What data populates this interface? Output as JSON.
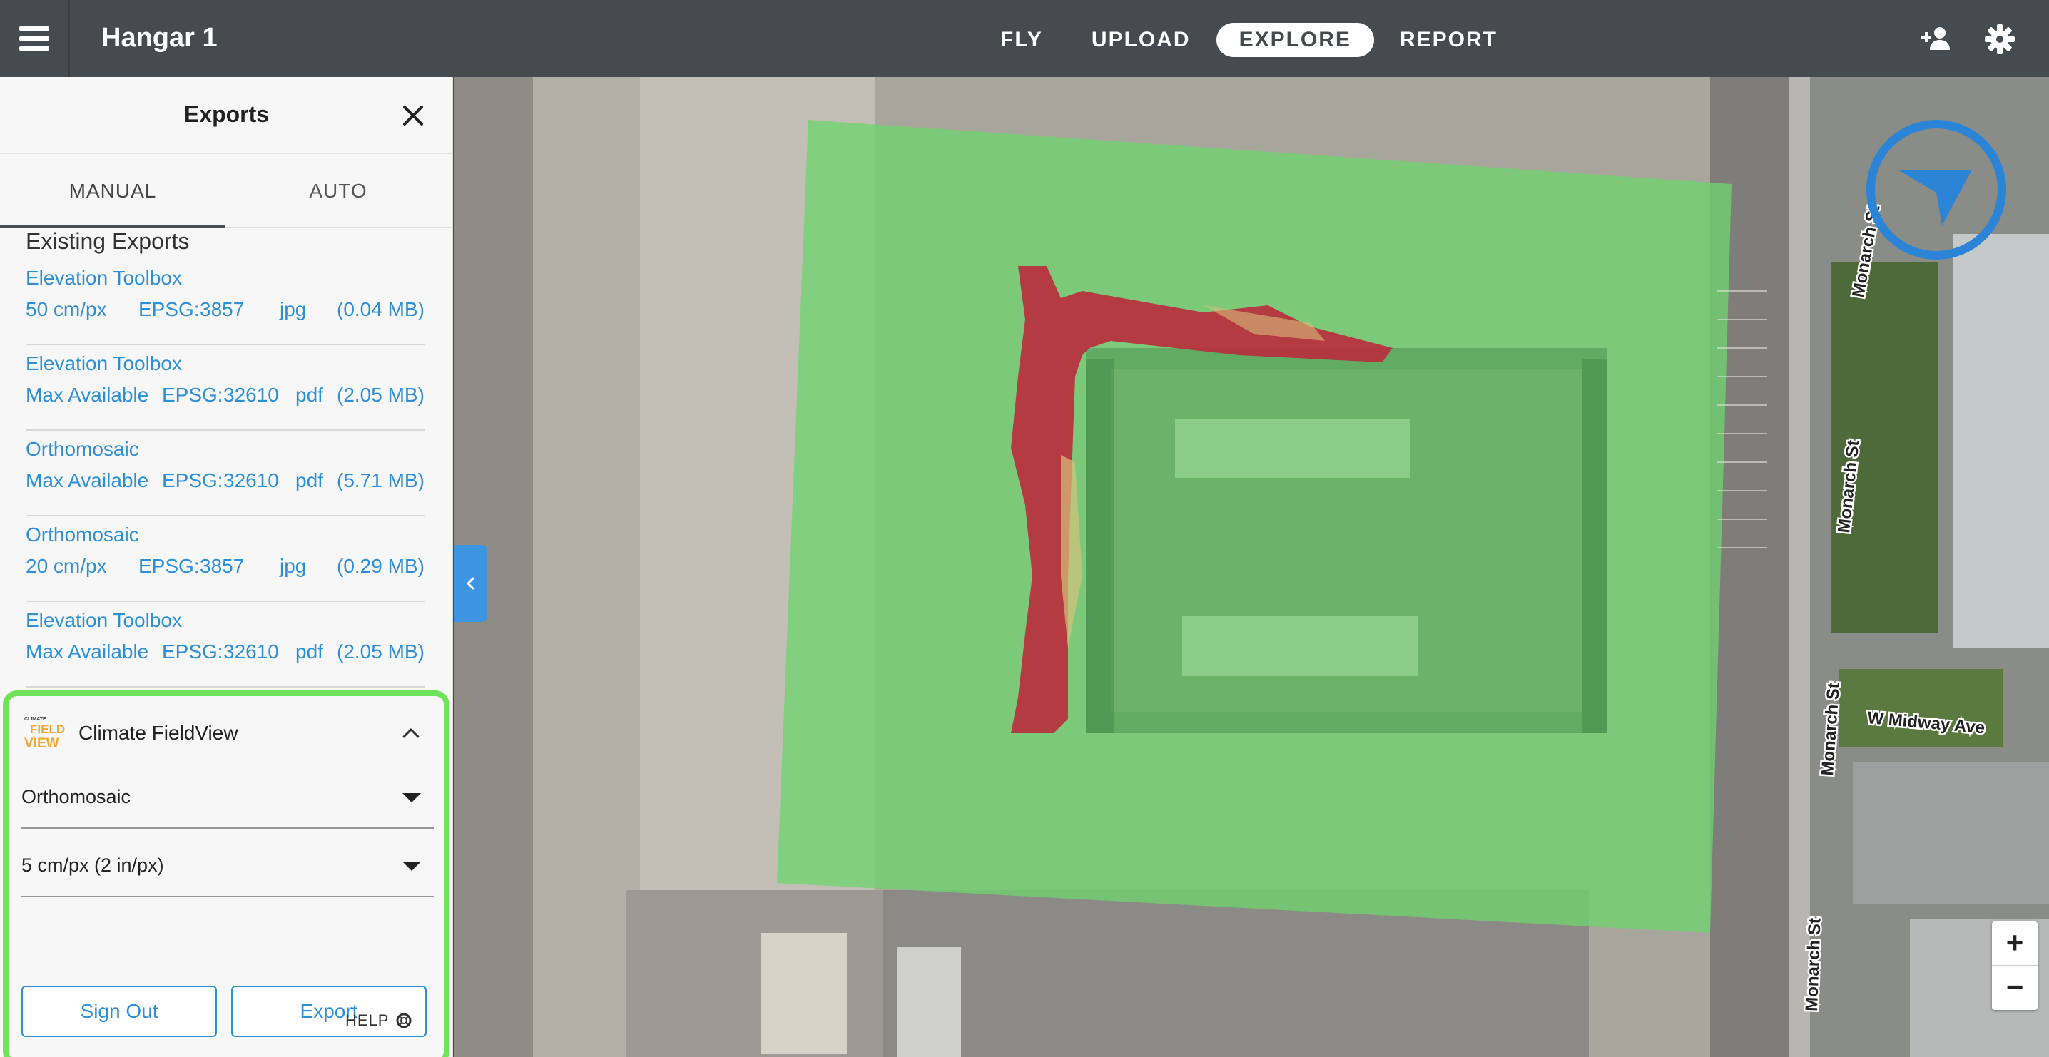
{
  "header": {
    "app_title": "Hangar 1",
    "nav_tabs": [
      {
        "label": "FLY",
        "active": false
      },
      {
        "label": "UPLOAD",
        "active": false
      },
      {
        "label": "EXPLORE",
        "active": true
      },
      {
        "label": "REPORT",
        "active": false
      }
    ]
  },
  "panel": {
    "title": "Exports",
    "tabs": [
      {
        "label": "MANUAL",
        "active": true
      },
      {
        "label": "AUTO",
        "active": false
      }
    ],
    "existing_heading": "Existing Exports",
    "exports": [
      {
        "name": "Elevation Toolbox",
        "resolution": "50 cm/px",
        "epsg_label": "EPSG:",
        "epsg": "3857",
        "format": "jpg",
        "size": "(0.04 MB)"
      },
      {
        "name": "Elevation Toolbox",
        "resolution": "Max Available",
        "epsg_label": "EPSG:",
        "epsg": "32610",
        "format": "pdf",
        "size": "(2.05 MB)"
      },
      {
        "name": "Orthomosaic",
        "resolution": "Max Available",
        "epsg_label": "EPSG:",
        "epsg": "32610",
        "format": "pdf",
        "size": "(5.71 MB)"
      },
      {
        "name": "Orthomosaic",
        "resolution": "20 cm/px",
        "epsg_label": "EPSG:",
        "epsg": "3857",
        "format": "jpg",
        "size": "(0.29 MB)"
      },
      {
        "name": "Elevation Toolbox",
        "resolution": "Max Available",
        "epsg_label": "EPSG:",
        "epsg": "32610",
        "format": "pdf",
        "size": "(2.05 MB)"
      }
    ],
    "fieldview": {
      "logo_text_top": "CLIMATE",
      "logo_text_mid": "FIELD",
      "logo_text_bot": "VIEW",
      "title": "Climate FieldView",
      "layer_select": "Orthomosaic",
      "resolution_select": "5 cm/px (2 in/px)",
      "sign_out_label": "Sign Out",
      "export_label": "Export"
    },
    "help_label": "HELP"
  },
  "map": {
    "street_labels": [
      "Monarch St",
      "Monarch St",
      "Monarch St",
      "Monarch St",
      "W Midway Ave"
    ],
    "zoom_in": "+",
    "zoom_out": "−"
  },
  "colors": {
    "accent": "#2e8fd9",
    "highlight_border": "#6fe35a",
    "topbar": "#464b4f",
    "overlay_green": "#6fd36f",
    "overlay_red": "#c0223a"
  }
}
